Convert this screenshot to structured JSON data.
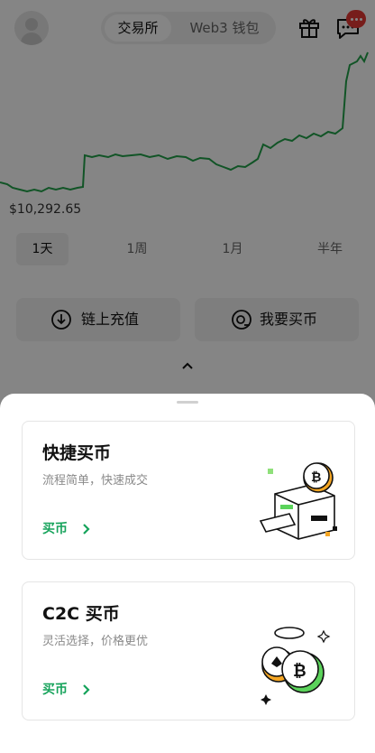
{
  "header": {
    "tabs": [
      {
        "label": "交易所",
        "active": true
      },
      {
        "label": "Web3 钱包",
        "active": false
      }
    ],
    "icons": {
      "avatar": "avatar-icon",
      "gift": "gift-icon",
      "chat": "chat-icon"
    }
  },
  "chart": {
    "low_label": "$10,292.65",
    "line_color": "#22a24a"
  },
  "periods": [
    "1天",
    "1周",
    "1月",
    "半年"
  ],
  "actions": {
    "deposit_label": "链上充值",
    "buy_label": "我要买币"
  },
  "sheet": {
    "cards": [
      {
        "title": "快捷买币",
        "subtitle": "流程简单，快速成交",
        "link": "买币"
      },
      {
        "title": "C2C 买币",
        "subtitle": "灵活选择，价格更优",
        "link": "买币"
      }
    ]
  },
  "colors": {
    "accent": "#16a35b",
    "badge": "#e53935"
  }
}
